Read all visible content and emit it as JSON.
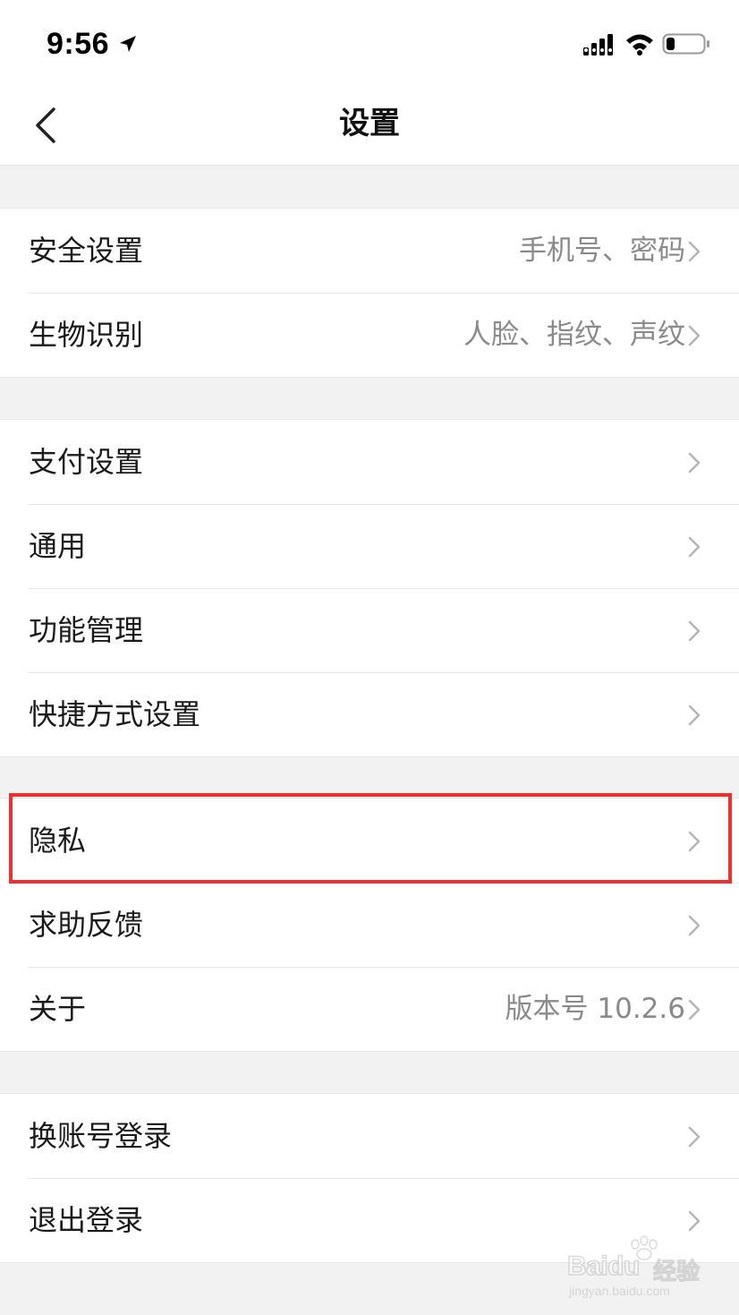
{
  "status_bar": {
    "time": "9:56",
    "icons": [
      "location-arrow-icon",
      "cellular-signal-icon",
      "wifi-icon",
      "battery-icon"
    ]
  },
  "nav": {
    "title": "设置",
    "back_icon": "chevron-left-icon"
  },
  "groups": [
    {
      "rows": [
        {
          "label": "安全设置",
          "value": "手机号、密码"
        },
        {
          "label": "生物识别",
          "value": "人脸、指纹、声纹"
        }
      ]
    },
    {
      "rows": [
        {
          "label": "支付设置",
          "value": ""
        },
        {
          "label": "通用",
          "value": ""
        },
        {
          "label": "功能管理",
          "value": ""
        },
        {
          "label": "快捷方式设置",
          "value": ""
        }
      ]
    },
    {
      "rows": [
        {
          "label": "隐私",
          "value": "",
          "highlighted": true
        },
        {
          "label": "求助反馈",
          "value": ""
        },
        {
          "label": "关于",
          "value": "版本号 10.2.6"
        }
      ]
    },
    {
      "rows": [
        {
          "label": "换账号登录",
          "value": ""
        },
        {
          "label": "退出登录",
          "value": ""
        }
      ]
    }
  ],
  "colors": {
    "highlight": "#f03030",
    "page_background": "#f2f2f2",
    "secondary_text": "#8a8a8a"
  },
  "watermark": {
    "brand": "Baidu",
    "cn": "经验",
    "url": "jingyan.baidu.com"
  }
}
